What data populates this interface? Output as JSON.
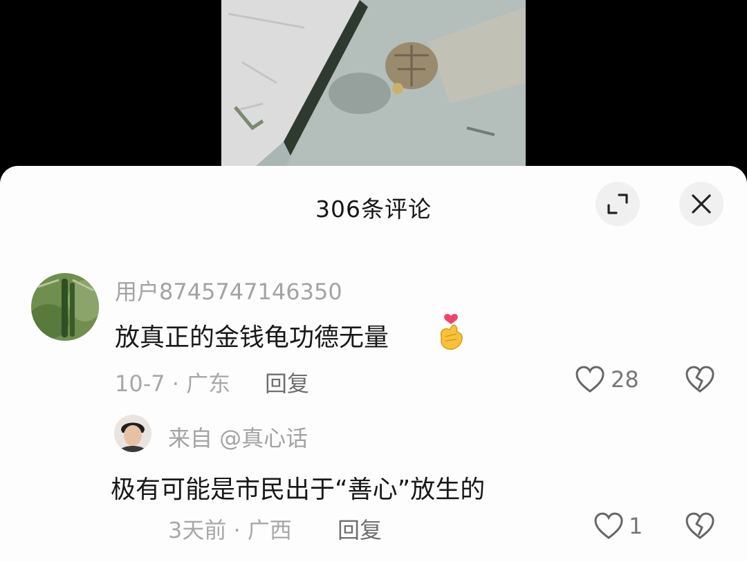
{
  "video": {
    "description_icon": "turtle-in-water"
  },
  "header": {
    "title": "306条评论",
    "expand_icon": "expand-icon",
    "close_icon": "close-icon"
  },
  "comments": [
    {
      "username": "用户8745747146350",
      "text": "放真正的金钱龟功德无量",
      "emoji_icon": "finger-heart-emoji-icon",
      "meta": "10-7 · 广东",
      "reply_label": "回复",
      "likes": "28",
      "like_icon": "heart-icon",
      "dislike_icon": "broken-heart-icon"
    },
    {
      "username": "来自 @真心话",
      "text": "极有可能是市民出于“善心”放生的",
      "meta": "3天前 · 广西",
      "reply_label": "回复",
      "likes": "1",
      "like_icon": "heart-icon",
      "dislike_icon": "broken-heart-icon"
    }
  ],
  "colors": {
    "sheet_bg": "#fdfdfd",
    "text_primary": "#181818",
    "text_secondary": "#a3a3a3",
    "button_bg": "#f0f0f0"
  }
}
